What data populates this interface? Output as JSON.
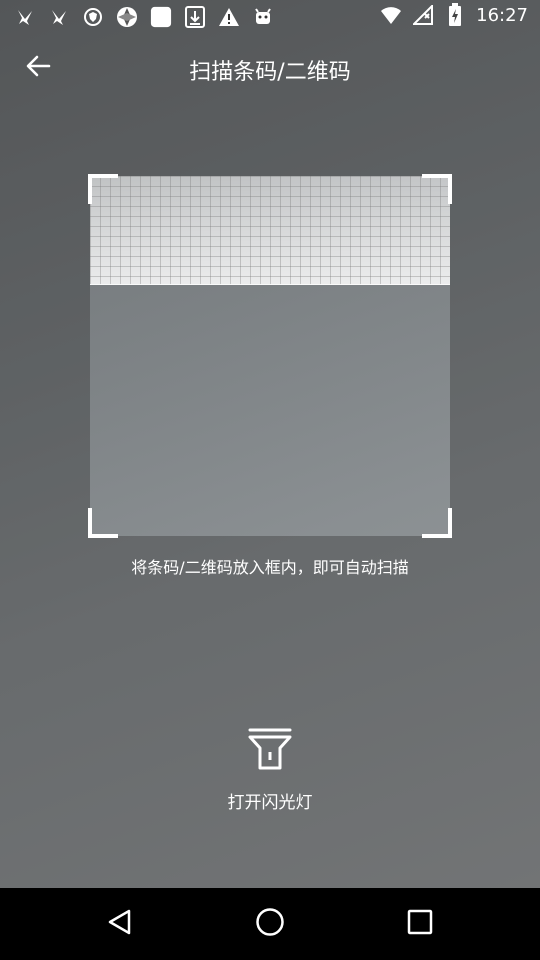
{
  "status_bar": {
    "time": "16:27",
    "left_icons": [
      "bird-icon",
      "bird-icon",
      "shield-icon",
      "aperture-icon",
      "square-icon",
      "download-icon",
      "warning-icon",
      "android-icon"
    ],
    "right_icons": [
      "wifi-icon",
      "no-sim-icon",
      "battery-charging-icon"
    ]
  },
  "app_bar": {
    "title": "扫描条码/二维码",
    "back_icon": "arrow-left-icon"
  },
  "scanner": {
    "hint": "将条码/二维码放入框内，即可自动扫描"
  },
  "flashlight": {
    "label": "打开闪光灯",
    "icon": "flashlight-icon"
  },
  "nav_bar": {
    "back_icon": "nav-back-icon",
    "home_icon": "nav-home-icon",
    "recents_icon": "nav-recents-icon"
  },
  "colors": {
    "text": "#ffffff",
    "nav_background": "#000000"
  }
}
